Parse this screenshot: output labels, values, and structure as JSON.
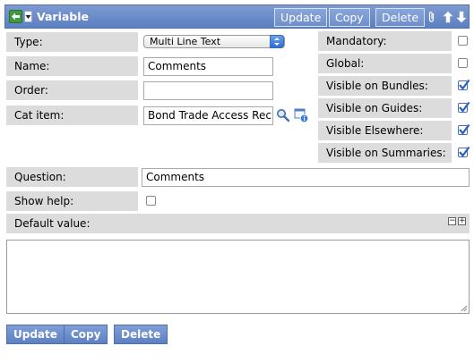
{
  "header": {
    "title": "Variable",
    "update_label": "Update",
    "copy_label": "Copy",
    "delete_label": "Delete",
    "back_icon": "back-arrow-icon",
    "menu_icon": "context-menu-icon",
    "attachment_icon": "paperclip-icon",
    "up_icon": "arrow-up-icon",
    "down_icon": "arrow-down-icon"
  },
  "form": {
    "type_label": "Type:",
    "type_value": "Multi Line Text",
    "name_label": "Name:",
    "name_value": "Comments",
    "order_label": "Order:",
    "order_value": "",
    "cat_item_label": "Cat item:",
    "cat_item_value": "Bond Trade Access Rec",
    "mandatory_label": "Mandatory:",
    "mandatory": false,
    "global_label": "Global:",
    "global": false,
    "visible_bundles_label": "Visible on Bundles:",
    "visible_bundles": true,
    "visible_guides_label": "Visible on Guides:",
    "visible_guides": true,
    "visible_elsewhere_label": "Visible Elsewhere:",
    "visible_elsewhere": true,
    "visible_summaries_label": "Visible on Summaries:",
    "visible_summaries": true,
    "question_label": "Question:",
    "question_value": "Comments",
    "show_help_label": "Show help:",
    "show_help": false,
    "default_value_label": "Default value:",
    "default_value": ""
  },
  "footer": {
    "update_label": "Update",
    "copy_label": "Copy",
    "delete_label": "Delete"
  },
  "colors": {
    "header_blue": "#5c7fc1",
    "label_gray": "#dcdcdc",
    "check_blue": "#2b5fc1"
  }
}
